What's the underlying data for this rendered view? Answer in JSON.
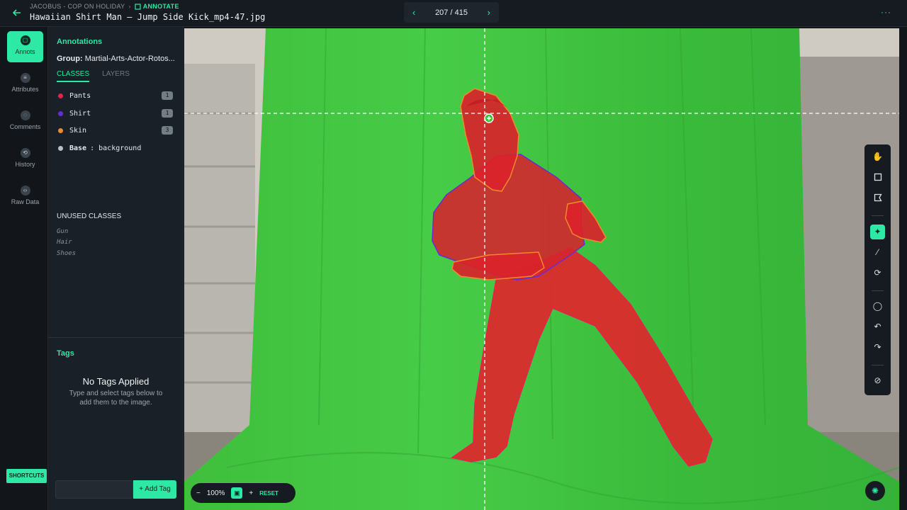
{
  "header": {
    "breadcrumb_project": "JACOBUS - COP ON HOLIDAY",
    "breadcrumb_sep": "›",
    "breadcrumb_mode": "ANNOTATE",
    "file_title": "Hawaiian Shirt Man – Jump Side Kick_mp4-47.jpg",
    "pager": {
      "prev": "‹",
      "count": "207 / 415",
      "next": "›"
    },
    "more": "···"
  },
  "nav": {
    "items": [
      {
        "label": "Annots",
        "icon": "annotations-icon",
        "glyph": "▢"
      },
      {
        "label": "Attributes",
        "icon": "list-icon",
        "glyph": "≡"
      },
      {
        "label": "Comments",
        "icon": "comment-icon",
        "glyph": "◌"
      },
      {
        "label": "History",
        "icon": "history-icon",
        "glyph": "⟲"
      },
      {
        "label": "Raw Data",
        "icon": "code-icon",
        "glyph": "‹›"
      }
    ],
    "shortcuts": "SHORTCUTS"
  },
  "panel": {
    "title": "Annotations",
    "group_label": "Group:",
    "group_value": "Martial-Arts-Actor-Rotos...",
    "tabs": [
      "CLASSES",
      "LAYERS"
    ],
    "classes": [
      {
        "name": "Pants",
        "count": "1",
        "color": "#e8204f"
      },
      {
        "name": "Shirt",
        "count": "1",
        "color": "#6a2ad8"
      },
      {
        "name": "Skin",
        "count": "3",
        "color": "#f08a2c"
      }
    ],
    "base_label": "Base",
    "base_value": ": background",
    "base_color": "#b8bfc6",
    "unused_heading": "UNUSED CLASSES",
    "unused": [
      "Gun",
      "Hair",
      "Shoes"
    ],
    "tags_heading": "Tags",
    "no_tags_title": "No Tags Applied",
    "no_tags_sub": "Type and select tags below to add them to the image.",
    "tag_input_value": "",
    "add_tag": "+ Add Tag"
  },
  "zoom": {
    "minus": "−",
    "value": "100%",
    "lock": "🔒",
    "plus": "+",
    "reset": "RESET"
  },
  "colors": {
    "accent": "#2ee8a5",
    "pants": "#e8204f",
    "shirt": "#6a2ad8",
    "skin": "#f08a2c"
  }
}
